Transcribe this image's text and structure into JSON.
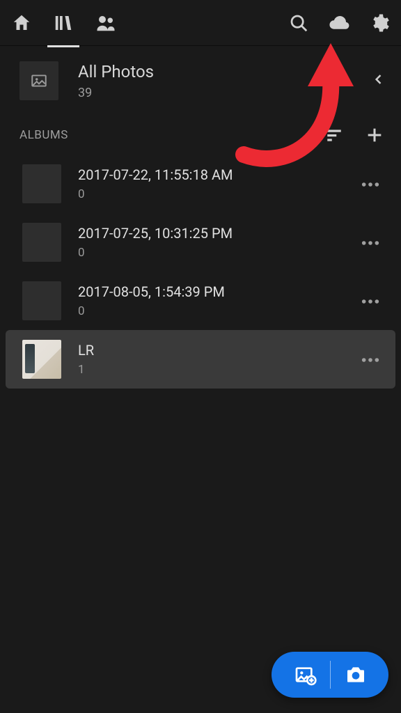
{
  "all_photos": {
    "label": "All Photos",
    "count": "39"
  },
  "albums_header": {
    "label": "ALBUMS"
  },
  "albums": [
    {
      "title": "2017-07-22, 11:55:18 AM",
      "count": "0"
    },
    {
      "title": "2017-07-25, 10:31:25 PM",
      "count": "0"
    },
    {
      "title": "2017-08-05, 1:54:39 PM",
      "count": "0"
    },
    {
      "title": "LR",
      "count": "1",
      "selected": true,
      "has_thumb": true
    }
  ]
}
